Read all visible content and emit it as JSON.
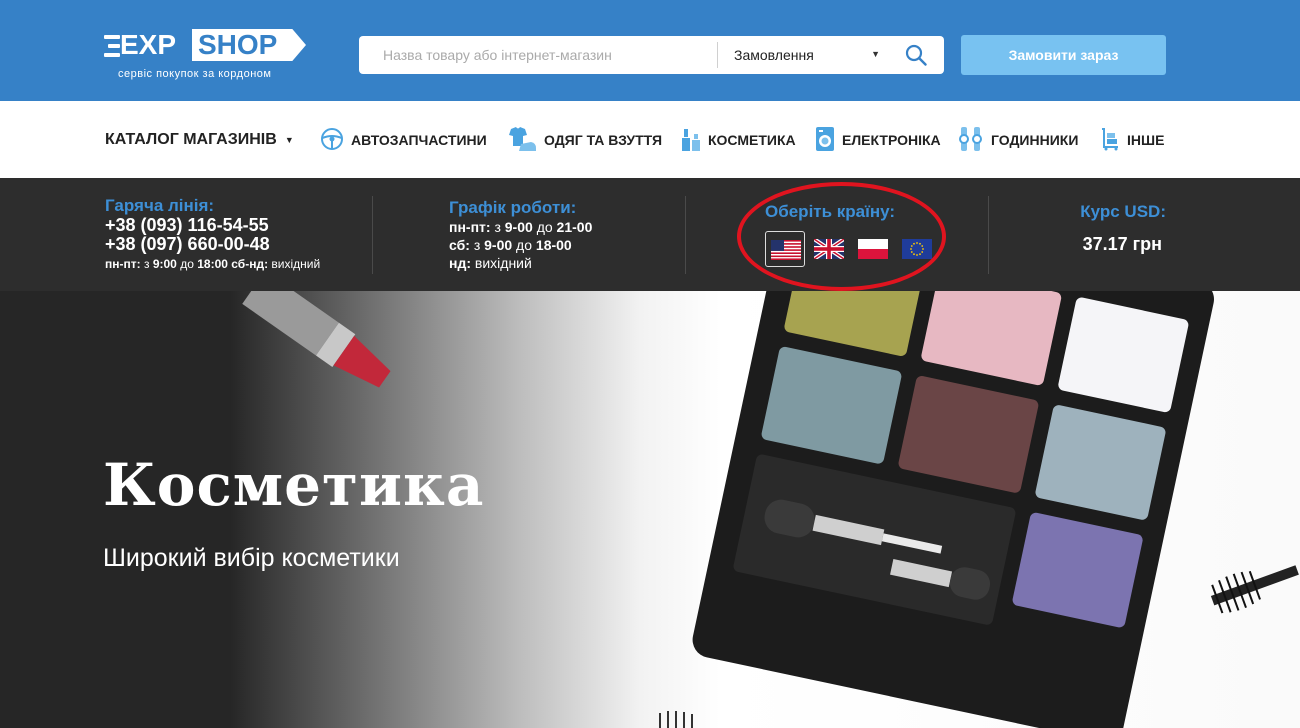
{
  "header": {
    "logo": {
      "exp": "EXP",
      "shop": "SHOP",
      "tagline": "сервіс покупок за кордоном"
    },
    "search": {
      "placeholder": "Назва товару або інтернет-магазин",
      "value": "",
      "select_value": "Замовлення"
    },
    "order_button": "Замовити зараз",
    "colors": {
      "bar": "#3681c7",
      "order_button": "#78c2f1"
    }
  },
  "nav": {
    "catalog": "КАТАЛОГ МАГАЗИНІВ",
    "items": [
      {
        "label": "АВТОЗАПЧАСТИНИ",
        "icon": "steering-wheel-icon"
      },
      {
        "label": "ОДЯГ ТА ВЗУТТЯ",
        "icon": "clothes-icon"
      },
      {
        "label": "КОСМЕТИКА",
        "icon": "cosmetics-icon"
      },
      {
        "label": "ЕЛЕКТРОНІКА",
        "icon": "washing-machine-icon"
      },
      {
        "label": "ГОДИННИКИ",
        "icon": "watch-icon"
      },
      {
        "label": "ІНШЕ",
        "icon": "cart-icon"
      }
    ]
  },
  "info": {
    "hotline": {
      "title": "Гаряча лінія:",
      "phone1": "+38 (093) 116-54-55",
      "phone2": "+38 (097) 660-00-48",
      "hours_days1": "пн-пт:",
      "hours_from": "з",
      "hours_t1": "9:00",
      "hours_to": "до",
      "hours_t2": "18:00",
      "hours_days2": "сб-нд:",
      "hours_off": "вихідний"
    },
    "schedule": {
      "title": "Графік роботи:",
      "l1_days": "пн-пт:",
      "l1_from": "з",
      "l1_t1": "9-00",
      "l1_to": "до",
      "l1_t2": "21-00",
      "l2_days": "сб:",
      "l2_from": "з",
      "l2_t1": "9-00",
      "l2_to": "до",
      "l2_t2": "18-00",
      "l3_days": "нд:",
      "l3_off": "вихідний"
    },
    "country": {
      "title": "Оберіть країну:",
      "flags": [
        "usa-flag-icon",
        "uk-flag-icon",
        "poland-flag-icon",
        "eu-flag-icon"
      ],
      "selected": "usa-flag-icon"
    },
    "rate": {
      "title": "Курс USD:",
      "value": "37.17 грн"
    },
    "colors": {
      "bar": "#2d2d2d",
      "heading": "#3d8fd6",
      "highlight": "#e0141f"
    }
  },
  "hero": {
    "title": "Косметика",
    "subtitle": "Широкий вибір косметики"
  }
}
